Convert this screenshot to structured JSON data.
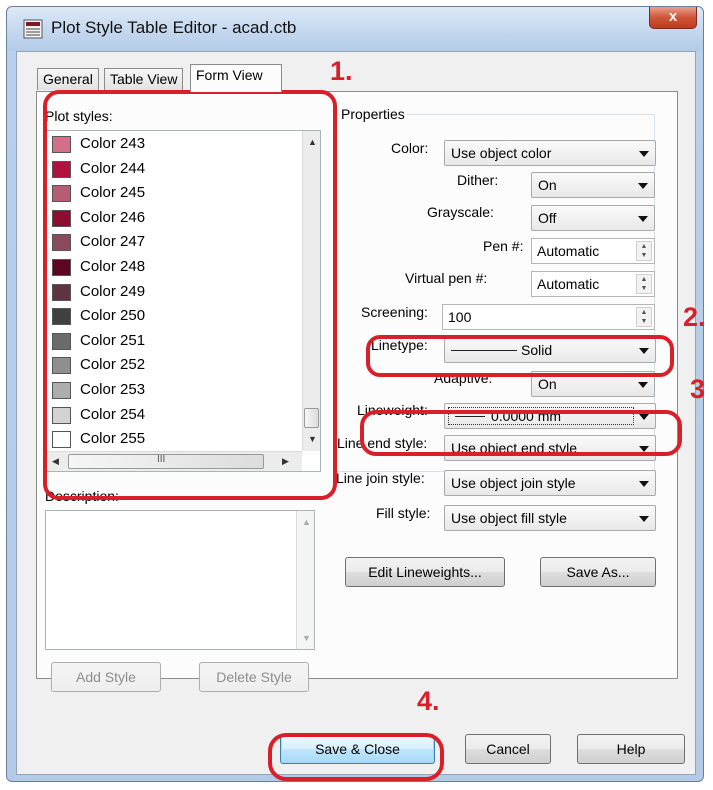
{
  "window": {
    "title": "Plot Style Table Editor - acad.ctb",
    "close_label": "x"
  },
  "tabs": [
    {
      "label": "General"
    },
    {
      "label": "Table View"
    },
    {
      "label": "Form View",
      "active": true
    }
  ],
  "plot_styles": {
    "label": "Plot styles:",
    "items": [
      {
        "label": "Color 243",
        "color": "#d46f8b"
      },
      {
        "label": "Color 244",
        "color": "#b0123d"
      },
      {
        "label": "Color 245",
        "color": "#b65c74"
      },
      {
        "label": "Color 246",
        "color": "#8c0d31"
      },
      {
        "label": "Color 247",
        "color": "#8a4a5c"
      },
      {
        "label": "Color 248",
        "color": "#5e0621"
      },
      {
        "label": "Color 249",
        "color": "#5e3440"
      },
      {
        "label": "Color 250",
        "color": "#404040"
      },
      {
        "label": "Color 251",
        "color": "#6b6b6b"
      },
      {
        "label": "Color 252",
        "color": "#8f8f8f"
      },
      {
        "label": "Color 253",
        "color": "#adadad"
      },
      {
        "label": "Color 254",
        "color": "#d2d2d2"
      },
      {
        "label": "Color 255",
        "color": "#ffffff"
      }
    ],
    "hscroll_thumb_glyph": "III"
  },
  "description": {
    "label": "Description:"
  },
  "buttons_left": {
    "add_style": "Add Style",
    "delete_style": "Delete Style"
  },
  "properties": {
    "label": "Properties",
    "color": {
      "label": "Color:",
      "value": "Use object color"
    },
    "dither": {
      "label": "Dither:",
      "value": "On"
    },
    "grayscale": {
      "label": "Grayscale:",
      "value": "Off"
    },
    "pen": {
      "label": "Pen #:",
      "value": "Automatic"
    },
    "virtual_pen": {
      "label": "Virtual pen #:",
      "value": "Automatic"
    },
    "screening": {
      "label": "Screening:",
      "value": "100"
    },
    "linetype": {
      "label": "Linetype:",
      "value": "Solid"
    },
    "adaptive": {
      "label": "Adaptive:",
      "value": "On"
    },
    "lineweight": {
      "label": "Lineweight:",
      "value": "0.0000 mm"
    },
    "line_end": {
      "label": "Line end style:",
      "value": "Use object end style"
    },
    "line_join": {
      "label": "Line join style:",
      "value": "Use object join style"
    },
    "fill": {
      "label": "Fill style:",
      "value": "Use object fill style"
    }
  },
  "buttons_right": {
    "edit_lineweights": "Edit Lineweights...",
    "save_as": "Save As..."
  },
  "footer": {
    "save_close": "Save & Close",
    "cancel": "Cancel",
    "help": "Help"
  },
  "annotations": {
    "step1": "1.",
    "step2": "2.",
    "step3": "3",
    "step4": "4.",
    "color": "#d8202a"
  }
}
